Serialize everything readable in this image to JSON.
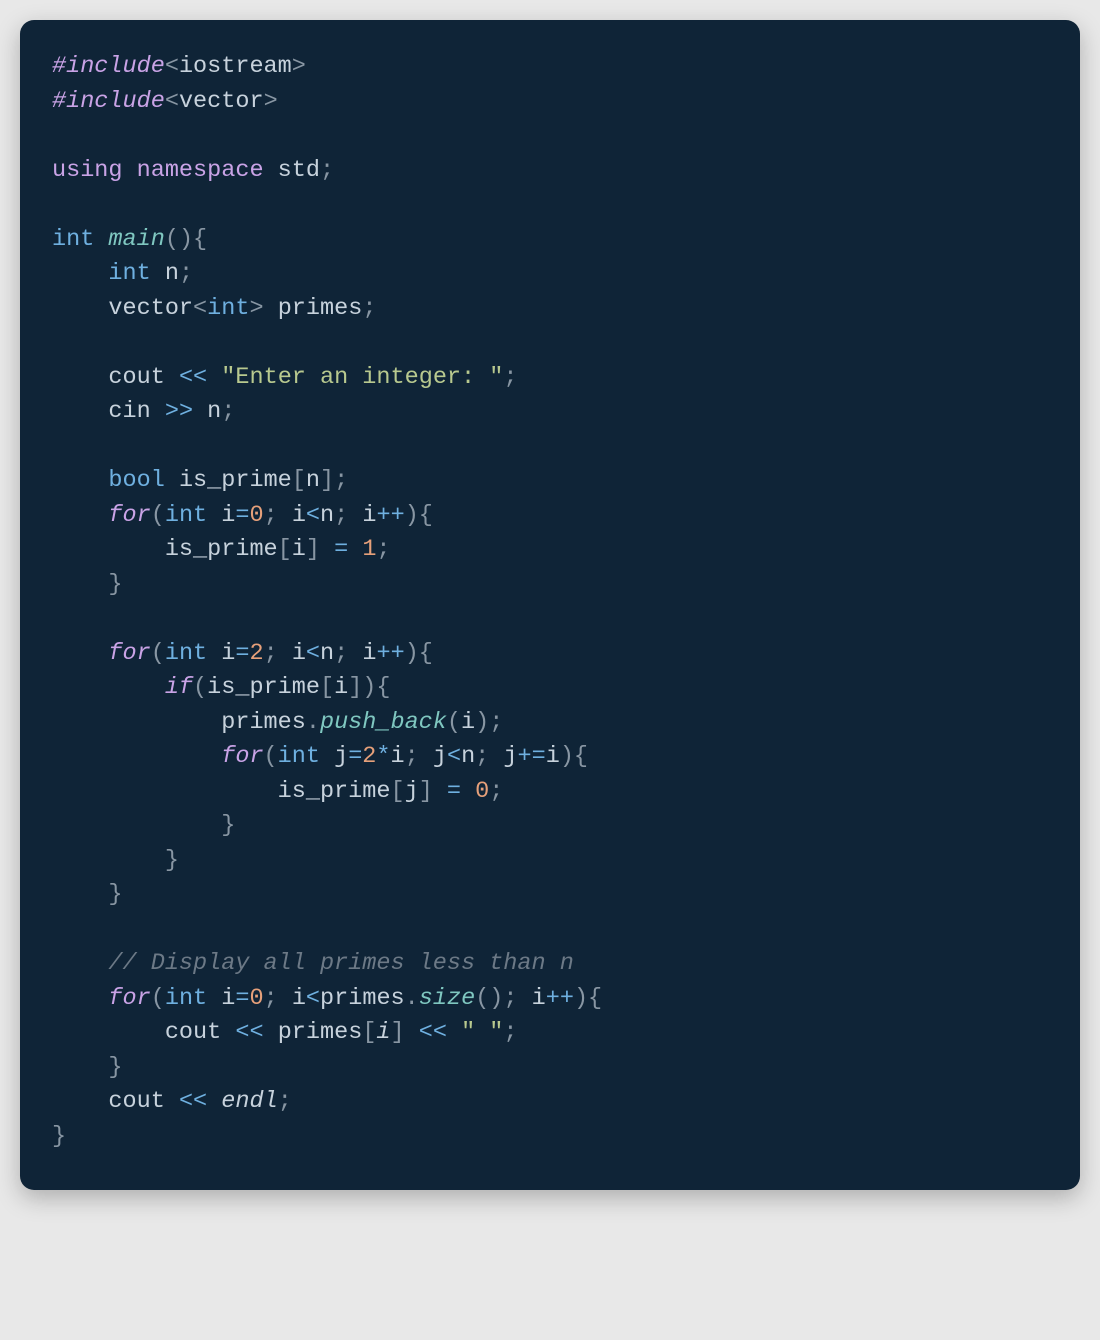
{
  "code": {
    "lines": [
      [
        {
          "cls": "tok-preproc",
          "t": "#include"
        },
        {
          "cls": "tok-punct",
          "t": "<"
        },
        {
          "cls": "tok-ident",
          "t": "iostream"
        },
        {
          "cls": "tok-punct",
          "t": ">"
        }
      ],
      [
        {
          "cls": "tok-preproc",
          "t": "#include"
        },
        {
          "cls": "tok-punct",
          "t": "<"
        },
        {
          "cls": "tok-ident",
          "t": "vector"
        },
        {
          "cls": "tok-punct",
          "t": ">"
        }
      ],
      [],
      [
        {
          "cls": "tok-keyword",
          "t": "using"
        },
        {
          "cls": "",
          "t": " "
        },
        {
          "cls": "tok-keyword",
          "t": "namespace"
        },
        {
          "cls": "",
          "t": " "
        },
        {
          "cls": "tok-ident",
          "t": "std"
        },
        {
          "cls": "tok-punct",
          "t": ";"
        }
      ],
      [],
      [
        {
          "cls": "tok-type",
          "t": "int"
        },
        {
          "cls": "",
          "t": " "
        },
        {
          "cls": "tok-func-i",
          "t": "main"
        },
        {
          "cls": "tok-punct",
          "t": "(){"
        }
      ],
      [
        {
          "cls": "",
          "t": "    "
        },
        {
          "cls": "tok-type",
          "t": "int"
        },
        {
          "cls": "",
          "t": " "
        },
        {
          "cls": "tok-var",
          "t": "n"
        },
        {
          "cls": "tok-punct",
          "t": ";"
        }
      ],
      [
        {
          "cls": "",
          "t": "    "
        },
        {
          "cls": "tok-ident",
          "t": "vector"
        },
        {
          "cls": "tok-punct",
          "t": "<"
        },
        {
          "cls": "tok-type",
          "t": "int"
        },
        {
          "cls": "tok-punct",
          "t": "> "
        },
        {
          "cls": "tok-var",
          "t": "primes"
        },
        {
          "cls": "tok-punct",
          "t": ";"
        }
      ],
      [],
      [
        {
          "cls": "",
          "t": "    "
        },
        {
          "cls": "tok-ident",
          "t": "cout"
        },
        {
          "cls": "",
          "t": " "
        },
        {
          "cls": "tok-op",
          "t": "<<"
        },
        {
          "cls": "",
          "t": " "
        },
        {
          "cls": "tok-string",
          "t": "\"Enter an integer: \""
        },
        {
          "cls": "tok-punct",
          "t": ";"
        }
      ],
      [
        {
          "cls": "",
          "t": "    "
        },
        {
          "cls": "tok-ident",
          "t": "cin"
        },
        {
          "cls": "",
          "t": " "
        },
        {
          "cls": "tok-op",
          "t": ">>"
        },
        {
          "cls": "",
          "t": " "
        },
        {
          "cls": "tok-var",
          "t": "n"
        },
        {
          "cls": "tok-punct",
          "t": ";"
        }
      ],
      [],
      [
        {
          "cls": "",
          "t": "    "
        },
        {
          "cls": "tok-type",
          "t": "bool"
        },
        {
          "cls": "",
          "t": " "
        },
        {
          "cls": "tok-var",
          "t": "is_prime"
        },
        {
          "cls": "tok-punct",
          "t": "["
        },
        {
          "cls": "tok-var",
          "t": "n"
        },
        {
          "cls": "tok-punct",
          "t": "];"
        }
      ],
      [
        {
          "cls": "",
          "t": "    "
        },
        {
          "cls": "tok-keyword-i",
          "t": "for"
        },
        {
          "cls": "tok-punct",
          "t": "("
        },
        {
          "cls": "tok-type",
          "t": "int"
        },
        {
          "cls": "",
          "t": " "
        },
        {
          "cls": "tok-var",
          "t": "i"
        },
        {
          "cls": "tok-op",
          "t": "="
        },
        {
          "cls": "tok-number",
          "t": "0"
        },
        {
          "cls": "tok-punct",
          "t": "; "
        },
        {
          "cls": "tok-var",
          "t": "i"
        },
        {
          "cls": "tok-op",
          "t": "<"
        },
        {
          "cls": "tok-var",
          "t": "n"
        },
        {
          "cls": "tok-punct",
          "t": "; "
        },
        {
          "cls": "tok-var",
          "t": "i"
        },
        {
          "cls": "tok-op",
          "t": "++"
        },
        {
          "cls": "tok-punct",
          "t": "){"
        }
      ],
      [
        {
          "cls": "",
          "t": "        "
        },
        {
          "cls": "tok-var",
          "t": "is_prime"
        },
        {
          "cls": "tok-punct",
          "t": "["
        },
        {
          "cls": "tok-var",
          "t": "i"
        },
        {
          "cls": "tok-punct",
          "t": "] "
        },
        {
          "cls": "tok-op",
          "t": "="
        },
        {
          "cls": "",
          "t": " "
        },
        {
          "cls": "tok-number",
          "t": "1"
        },
        {
          "cls": "tok-punct",
          "t": ";"
        }
      ],
      [
        {
          "cls": "",
          "t": "    "
        },
        {
          "cls": "tok-punct",
          "t": "}"
        }
      ],
      [],
      [
        {
          "cls": "",
          "t": "    "
        },
        {
          "cls": "tok-keyword-i",
          "t": "for"
        },
        {
          "cls": "tok-punct",
          "t": "("
        },
        {
          "cls": "tok-type",
          "t": "int"
        },
        {
          "cls": "",
          "t": " "
        },
        {
          "cls": "tok-var",
          "t": "i"
        },
        {
          "cls": "tok-op",
          "t": "="
        },
        {
          "cls": "tok-number",
          "t": "2"
        },
        {
          "cls": "tok-punct",
          "t": "; "
        },
        {
          "cls": "tok-var",
          "t": "i"
        },
        {
          "cls": "tok-op",
          "t": "<"
        },
        {
          "cls": "tok-var",
          "t": "n"
        },
        {
          "cls": "tok-punct",
          "t": "; "
        },
        {
          "cls": "tok-var",
          "t": "i"
        },
        {
          "cls": "tok-op",
          "t": "++"
        },
        {
          "cls": "tok-punct",
          "t": "){"
        }
      ],
      [
        {
          "cls": "",
          "t": "        "
        },
        {
          "cls": "tok-keyword-i",
          "t": "if"
        },
        {
          "cls": "tok-punct",
          "t": "("
        },
        {
          "cls": "tok-var",
          "t": "is_prime"
        },
        {
          "cls": "tok-punct",
          "t": "["
        },
        {
          "cls": "tok-var",
          "t": "i"
        },
        {
          "cls": "tok-punct",
          "t": "]){"
        }
      ],
      [
        {
          "cls": "",
          "t": "            "
        },
        {
          "cls": "tok-var",
          "t": "primes"
        },
        {
          "cls": "tok-punct",
          "t": "."
        },
        {
          "cls": "tok-func-i",
          "t": "push_back"
        },
        {
          "cls": "tok-punct",
          "t": "("
        },
        {
          "cls": "tok-var",
          "t": "i"
        },
        {
          "cls": "tok-punct",
          "t": ");"
        }
      ],
      [
        {
          "cls": "",
          "t": "            "
        },
        {
          "cls": "tok-keyword-i",
          "t": "for"
        },
        {
          "cls": "tok-punct",
          "t": "("
        },
        {
          "cls": "tok-type",
          "t": "int"
        },
        {
          "cls": "",
          "t": " "
        },
        {
          "cls": "tok-var",
          "t": "j"
        },
        {
          "cls": "tok-op",
          "t": "="
        },
        {
          "cls": "tok-number",
          "t": "2"
        },
        {
          "cls": "tok-op",
          "t": "*"
        },
        {
          "cls": "tok-var",
          "t": "i"
        },
        {
          "cls": "tok-punct",
          "t": "; "
        },
        {
          "cls": "tok-var",
          "t": "j"
        },
        {
          "cls": "tok-op",
          "t": "<"
        },
        {
          "cls": "tok-var",
          "t": "n"
        },
        {
          "cls": "tok-punct",
          "t": "; "
        },
        {
          "cls": "tok-var",
          "t": "j"
        },
        {
          "cls": "tok-op",
          "t": "+="
        },
        {
          "cls": "tok-var",
          "t": "i"
        },
        {
          "cls": "tok-punct",
          "t": "){"
        }
      ],
      [
        {
          "cls": "",
          "t": "                "
        },
        {
          "cls": "tok-var",
          "t": "is_prime"
        },
        {
          "cls": "tok-punct",
          "t": "["
        },
        {
          "cls": "tok-var",
          "t": "j"
        },
        {
          "cls": "tok-punct",
          "t": "] "
        },
        {
          "cls": "tok-op",
          "t": "="
        },
        {
          "cls": "",
          "t": " "
        },
        {
          "cls": "tok-number",
          "t": "0"
        },
        {
          "cls": "tok-punct",
          "t": ";"
        }
      ],
      [
        {
          "cls": "",
          "t": "            "
        },
        {
          "cls": "tok-punct",
          "t": "}"
        }
      ],
      [
        {
          "cls": "",
          "t": "        "
        },
        {
          "cls": "tok-punct",
          "t": "}"
        }
      ],
      [
        {
          "cls": "",
          "t": "    "
        },
        {
          "cls": "tok-punct",
          "t": "}"
        }
      ],
      [],
      [
        {
          "cls": "",
          "t": "    "
        },
        {
          "cls": "tok-comment",
          "t": "// Display all primes less than n"
        }
      ],
      [
        {
          "cls": "",
          "t": "    "
        },
        {
          "cls": "tok-keyword-i",
          "t": "for"
        },
        {
          "cls": "tok-punct",
          "t": "("
        },
        {
          "cls": "tok-type",
          "t": "int"
        },
        {
          "cls": "",
          "t": " "
        },
        {
          "cls": "tok-var",
          "t": "i"
        },
        {
          "cls": "tok-op",
          "t": "="
        },
        {
          "cls": "tok-number",
          "t": "0"
        },
        {
          "cls": "tok-punct",
          "t": "; "
        },
        {
          "cls": "tok-var",
          "t": "i"
        },
        {
          "cls": "tok-op",
          "t": "<"
        },
        {
          "cls": "tok-var",
          "t": "primes"
        },
        {
          "cls": "tok-punct",
          "t": "."
        },
        {
          "cls": "tok-func-i",
          "t": "size"
        },
        {
          "cls": "tok-punct",
          "t": "(); "
        },
        {
          "cls": "tok-var",
          "t": "i"
        },
        {
          "cls": "tok-op",
          "t": "++"
        },
        {
          "cls": "tok-punct",
          "t": "){"
        }
      ],
      [
        {
          "cls": "",
          "t": "        "
        },
        {
          "cls": "tok-ident",
          "t": "cout"
        },
        {
          "cls": "",
          "t": " "
        },
        {
          "cls": "tok-op",
          "t": "<<"
        },
        {
          "cls": "",
          "t": " "
        },
        {
          "cls": "tok-var",
          "t": "primes"
        },
        {
          "cls": "tok-punct",
          "t": "["
        },
        {
          "cls": "tok-var-i",
          "t": "i"
        },
        {
          "cls": "tok-punct",
          "t": "]"
        },
        {
          "cls": "",
          "t": " "
        },
        {
          "cls": "tok-op",
          "t": "<<"
        },
        {
          "cls": "",
          "t": " "
        },
        {
          "cls": "tok-string",
          "t": "\" \""
        },
        {
          "cls": "tok-punct",
          "t": ";"
        }
      ],
      [
        {
          "cls": "",
          "t": "    "
        },
        {
          "cls": "tok-punct",
          "t": "}"
        }
      ],
      [
        {
          "cls": "",
          "t": "    "
        },
        {
          "cls": "tok-ident",
          "t": "cout"
        },
        {
          "cls": "",
          "t": " "
        },
        {
          "cls": "tok-op",
          "t": "<<"
        },
        {
          "cls": "",
          "t": " "
        },
        {
          "cls": "tok-endl",
          "t": "endl"
        },
        {
          "cls": "tok-punct",
          "t": ";"
        }
      ],
      [
        {
          "cls": "tok-punct",
          "t": "}"
        }
      ]
    ]
  }
}
